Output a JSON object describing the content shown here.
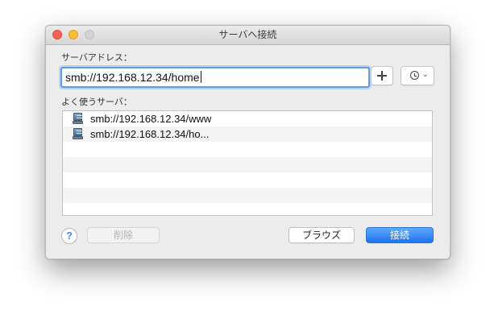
{
  "window": {
    "title": "サーバへ接続"
  },
  "server_address": {
    "label": "サーバアドレス：",
    "value": "smb://192.168.12.34/home"
  },
  "favorites": {
    "label": "よく使うサーバ：",
    "items": [
      {
        "text": "smb://192.168.12.34/www",
        "icon": "network-server-icon"
      },
      {
        "text": "smb://192.168.12.34/ho...",
        "icon": "network-server-icon"
      }
    ]
  },
  "buttons": {
    "help": "?",
    "delete": "削除",
    "browse": "ブラウズ",
    "connect": "接続"
  },
  "colors": {
    "accent": "#1d74f0",
    "close": "#fc5f57",
    "minimize": "#fdbc2e",
    "zoom_disabled": "#d2d2d2"
  }
}
